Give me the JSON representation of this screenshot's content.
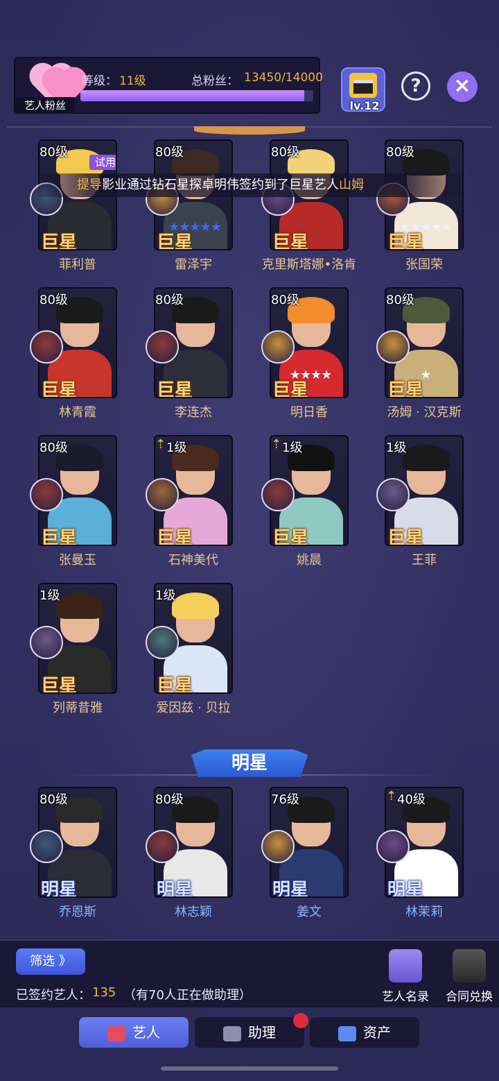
{
  "header": {
    "fans_tag": "艺人粉丝",
    "level_label": "等级：",
    "level_value": "11级",
    "fans_label": "总粉丝：",
    "fans_value": "13450/14000",
    "fans_progress": 0.961,
    "clapper_level": "lv.12",
    "help_icon": "?",
    "close_icon": "×"
  },
  "banner": {
    "prefix": "提导",
    "middle": "影业通过钻石星探卓明伟签约到了巨星艺人",
    "highlight": "山姆"
  },
  "superstars": [
    {
      "name": "菲利普",
      "level": "80级",
      "rank": "巨星",
      "trial": "试用",
      "stars": ""
    },
    {
      "name": "雷泽宇",
      "level": "80级",
      "rank": "巨星",
      "stars": "★★★★★",
      "star_color": "#3a6cf0"
    },
    {
      "name": "克里斯塔娜•洛肯",
      "level": "80级",
      "rank": "巨星",
      "stars": ""
    },
    {
      "name": "张国荣",
      "level": "80级",
      "rank": "巨星",
      "stars": "★★★★★",
      "star_color": "#f0f2ff"
    },
    {
      "name": "林青霞",
      "level": "80级",
      "rank": "巨星",
      "stars": ""
    },
    {
      "name": "李连杰",
      "level": "80级",
      "rank": "巨星",
      "stars": ""
    },
    {
      "name": "明日香",
      "level": "80级",
      "rank": "巨星",
      "stars": "★★★★",
      "star_color": "#f0f2ff"
    },
    {
      "name": "汤姆 · 汉克斯",
      "level": "80级",
      "rank": "巨星",
      "stars": "★",
      "star_color": "#f0f2ff"
    },
    {
      "name": "张曼玉",
      "level": "80级",
      "rank": "巨星",
      "stars": ""
    },
    {
      "name": "石神美代",
      "level": "1级",
      "rank": "巨星",
      "up": "⇡",
      "stars": ""
    },
    {
      "name": "姚晨",
      "level": "1级",
      "rank": "巨星",
      "up": "⇡",
      "stars": ""
    },
    {
      "name": "王菲",
      "level": "1级",
      "rank": "巨星",
      "stars": ""
    },
    {
      "name": "列蒂昔雅",
      "level": "1级",
      "rank": "巨星",
      "stars": ""
    },
    {
      "name": "爱因兹 · 贝拉",
      "level": "1级",
      "rank": "巨星",
      "stars": ""
    }
  ],
  "section_title": "明星",
  "stars": [
    {
      "name": "乔恩斯",
      "level": "80级",
      "rank": "明星"
    },
    {
      "name": "林志颖",
      "level": "80级",
      "rank": "明星"
    },
    {
      "name": "姜文",
      "level": "76级",
      "rank": "明星"
    },
    {
      "name": "林茉莉",
      "level": "40级",
      "rank": "明星",
      "up": "⇡"
    }
  ],
  "bottom": {
    "filter_label": "筛选 》",
    "signed_label": "已签约艺人：",
    "signed_count": "135",
    "assist_text": "（有70人正在做助理）",
    "directory_label": "艺人名录",
    "contract_label": "合同兑换"
  },
  "tabs": [
    {
      "label": "艺人",
      "active": true
    },
    {
      "label": "助理",
      "active": false
    },
    {
      "label": "资产",
      "active": false
    }
  ],
  "colors": {
    "accent_gold": "#f2b43c",
    "accent_purple": "#9a5ff0",
    "tab_active": "#5a6ee6"
  }
}
